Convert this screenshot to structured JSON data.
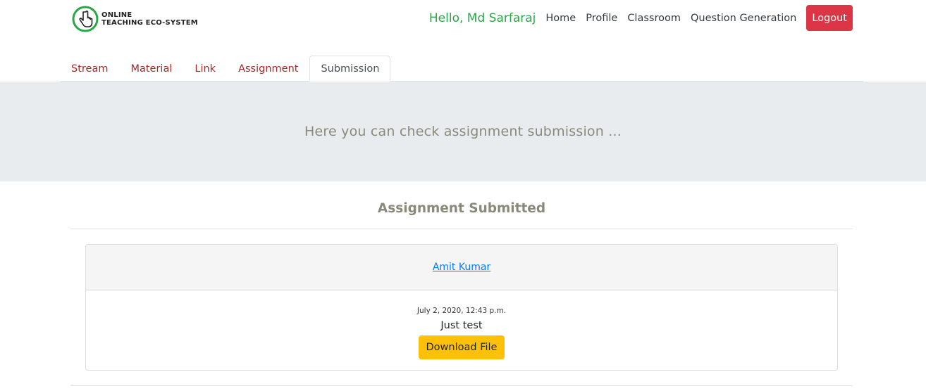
{
  "brand": {
    "line1": "ONLINE",
    "line2": "TEACHING ECO-SYSTEM",
    "logo_icon": "hand-pointer-icon",
    "logo_color": "#28a745"
  },
  "nav": {
    "greeting": "Hello, Md Sarfaraj",
    "links": [
      "Home",
      "Profile",
      "Classroom",
      "Question Generation"
    ],
    "logout": "Logout"
  },
  "tabs": {
    "items": [
      "Stream",
      "Material",
      "Link",
      "Assignment",
      "Submission"
    ],
    "active": "Submission"
  },
  "jumbotron": {
    "text": "Here you can check assignment submission ..."
  },
  "section": {
    "title": "Assignment Submitted"
  },
  "submission": {
    "student": "Amit Kumar",
    "date": "July 2, 2020, 12:43 p.m.",
    "note": "Just test",
    "download_label": "Download File"
  },
  "colors": {
    "greeting": "#28a745",
    "logout": "#dc3545",
    "tab_link": "#a52a2a",
    "download": "#ffc107",
    "link": "#007bff"
  }
}
